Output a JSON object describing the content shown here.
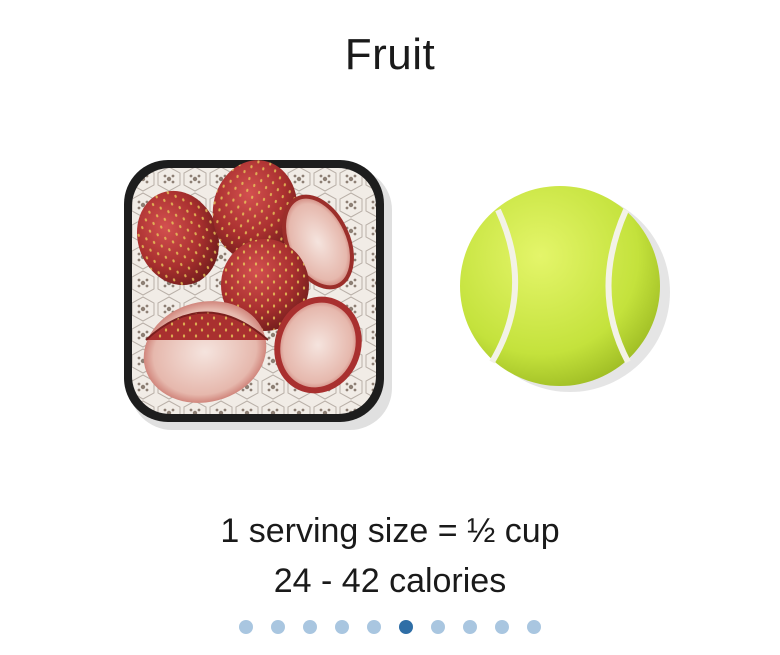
{
  "page": {
    "title": "Fruit",
    "serving_text": "1 serving size = ½ cup",
    "calories_text": "24 - 42 calories"
  },
  "illustration": {
    "left_item": "bowl of sliced strawberries",
    "right_item": "tennis ball"
  },
  "pagination": {
    "total": 10,
    "active_index": 5,
    "active_color": "#2f6ea6",
    "inactive_color": "#a9c6e0"
  }
}
